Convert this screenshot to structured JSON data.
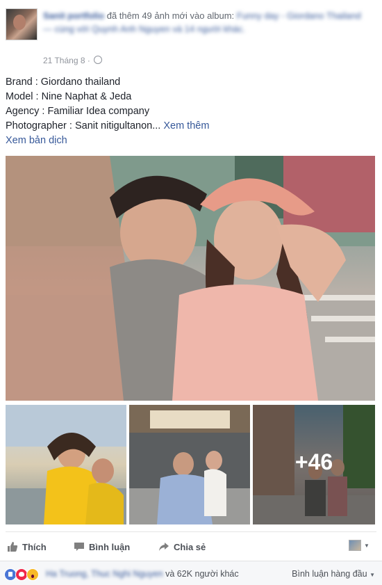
{
  "header": {
    "author_name": "Sanit portfolio",
    "action_text": "đã thêm 49 ảnh mới vào album:",
    "album_name": "Funny day - Giordano Thailand",
    "with_text": "— cùng với",
    "tagged_user": "Quynh Anh Nguyen",
    "and_others": "và 14 người khác.",
    "timestamp": "21 Tháng 8",
    "separator": "·"
  },
  "post": {
    "lines": [
      "Brand : Giordano thailand",
      "Model : Nine Naphat & Jeda",
      "Agency : Familiar Idea company"
    ],
    "last_line": "Photographer : Sanit nitigultanon...",
    "see_more": "Xem thêm",
    "see_translation": "Xem bản dịch"
  },
  "photos": {
    "more_count": "+46"
  },
  "actions": {
    "like": "Thích",
    "comment": "Bình luận",
    "share": "Chia sẻ"
  },
  "reactions": {
    "names": "Ha Truong, Thuc Nghi Nguyen",
    "others": "và 62K người khác",
    "sort_label": "Bình luận hàng đầu",
    "sort_caret": "▼"
  },
  "colors": {
    "link": "#365899",
    "text": "#1d2129",
    "muted": "#90949c"
  }
}
